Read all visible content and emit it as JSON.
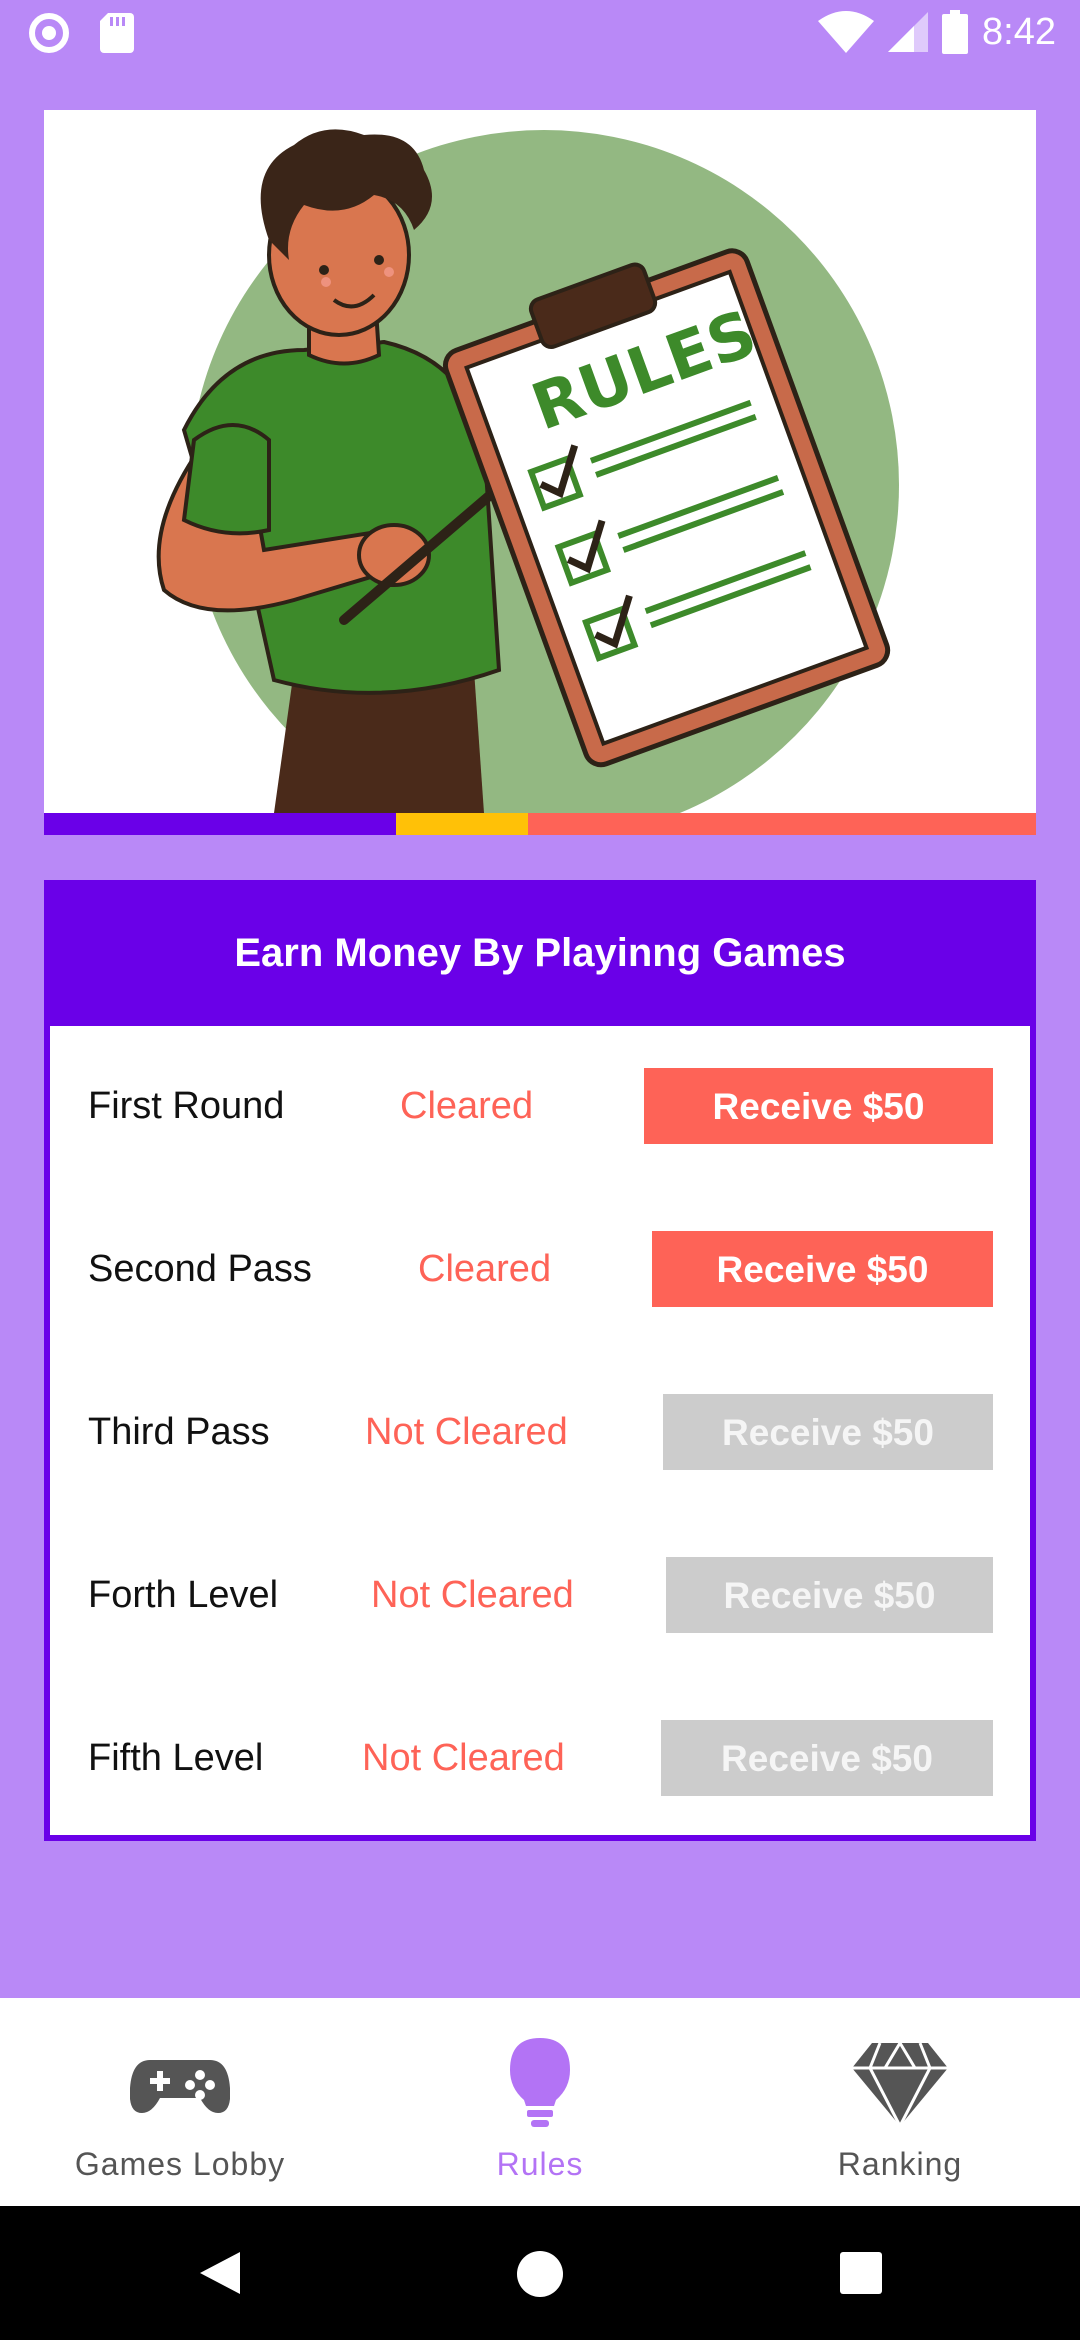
{
  "status_bar": {
    "time": "8:42",
    "left_icons": [
      "circle-notification-icon",
      "sd-card-icon"
    ],
    "right_icons": [
      "wifi-icon",
      "signal-icon",
      "battery-icon"
    ]
  },
  "banner": {
    "image": "rules-illustration",
    "clipboard_text": "RULES"
  },
  "card": {
    "title": "Earn Money By Playinng Games",
    "rows": [
      {
        "label": "First Round",
        "status": "Cleared",
        "button": "Receive $50",
        "enabled": true
      },
      {
        "label": "Second Pass",
        "status": "Cleared",
        "button": "Receive $50",
        "enabled": true
      },
      {
        "label": "Third Pass",
        "status": "Not Cleared",
        "button": "Receive $50",
        "enabled": false
      },
      {
        "label": "Forth Level",
        "status": "Not Cleared",
        "button": "Receive $50",
        "enabled": false
      },
      {
        "label": "Fifth Level",
        "status": "Not Cleared",
        "button": "Receive $50",
        "enabled": false
      }
    ]
  },
  "bottom_nav": {
    "items": [
      {
        "label": "Games Lobby",
        "icon": "gamepad-icon",
        "active": false
      },
      {
        "label": "Rules",
        "icon": "lightbulb-icon",
        "active": true
      },
      {
        "label": "Ranking",
        "icon": "diamond-icon",
        "active": false
      }
    ]
  },
  "colors": {
    "background": "#b989f7",
    "accent": "#6a00e8",
    "button_active": "#fe6357",
    "button_disabled": "#cccccc",
    "status_text": "#fe6357",
    "nav_active": "#b373f5"
  }
}
